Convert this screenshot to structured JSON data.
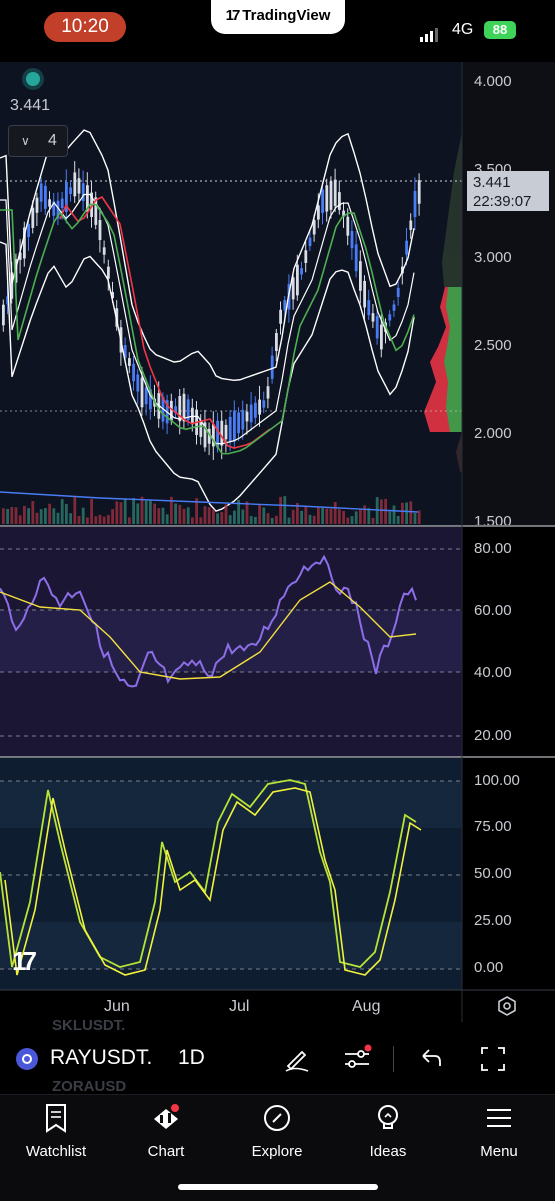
{
  "status_bar": {
    "time": "10:20",
    "app_name": "TradingView",
    "network": "4G",
    "battery": "88"
  },
  "chart": {
    "last_price": "3.441",
    "collapsed_indicators": "4",
    "price_axis": [
      "4.000",
      "3.500",
      "3.000",
      "2.500",
      "2.000",
      "1.500"
    ],
    "current_price": "3.441",
    "countdown": "22:39:07",
    "rsi_axis": [
      "80.00",
      "60.00",
      "40.00",
      "20.00"
    ],
    "stoch_axis": [
      "100.00",
      "75.00",
      "50.00",
      "25.00",
      "0.00"
    ],
    "months": [
      "Jun",
      "Jul",
      "Aug"
    ],
    "colors": {
      "up": "#4a7cf5",
      "down": "#d9dde6",
      "bb": "#ffffff",
      "ema_red": "#f23645",
      "ema_green": "#4caf50",
      "rsi": "#8c6ee8",
      "rsi_ma": "#f2de3d",
      "stoch_k": "#b8e336",
      "stoch_d": "#f2f23d"
    }
  },
  "toolbar": {
    "watchlist_ghost_top": "SKLUSDT.",
    "watchlist_ghost_bottom": "ZORAUSD",
    "symbol": "RAYUSDT.",
    "interval": "1D"
  },
  "bottom_nav": [
    {
      "label": "Watchlist",
      "icon": "bookmark-icon"
    },
    {
      "label": "Chart",
      "icon": "chart-icon"
    },
    {
      "label": "Explore",
      "icon": "compass-icon"
    },
    {
      "label": "Ideas",
      "icon": "lightbulb-icon"
    },
    {
      "label": "Menu",
      "icon": "hamburger-icon"
    }
  ]
}
